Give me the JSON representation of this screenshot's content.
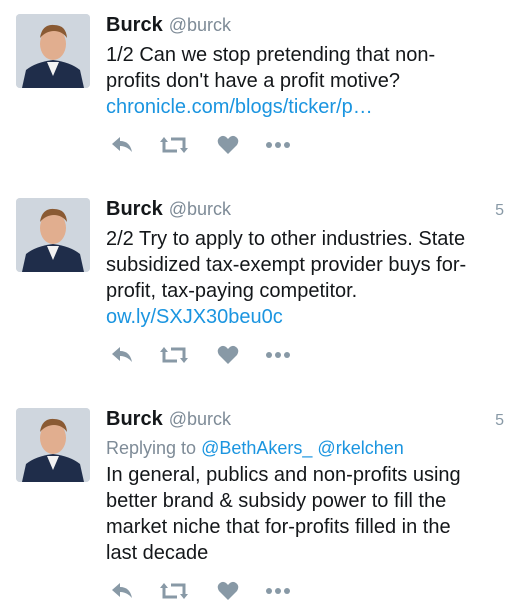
{
  "tweets": [
    {
      "name": "Burck",
      "handle": "@burck",
      "time": "",
      "reply_prefix": "",
      "mention1": "",
      "mention2": "",
      "lines": [
        "1/2 Can we stop pretending that non-",
        "profits don't have a profit motive?"
      ],
      "link": "chronicle.com/blogs/ticker/p…"
    },
    {
      "name": "Burck",
      "handle": "@burck",
      "time": "5",
      "reply_prefix": "",
      "mention1": "",
      "mention2": "",
      "lines": [
        "2/2 Try to apply to other industries. State",
        "subsidized tax-exempt provider buys for-",
        "profit, tax-paying competitor."
      ],
      "link": "ow.ly/SXJX30beu0c"
    },
    {
      "name": "Burck",
      "handle": "@burck",
      "time": "5",
      "reply_prefix": "Replying to",
      "mention1": "@BethAkers_",
      "mention2": "@rkelchen",
      "lines": [
        "In general, publics and non-profits using",
        "better brand & subsidy power to fill the",
        "market niche that for-profits filled in the",
        "last decade"
      ],
      "link": ""
    }
  ],
  "icons": [
    "reply-icon",
    "retweet-icon",
    "like-icon",
    "more-icon"
  ],
  "colors": {
    "link": "#1b95e0",
    "muted": "#7e8b97",
    "icon": "#8899a6"
  }
}
